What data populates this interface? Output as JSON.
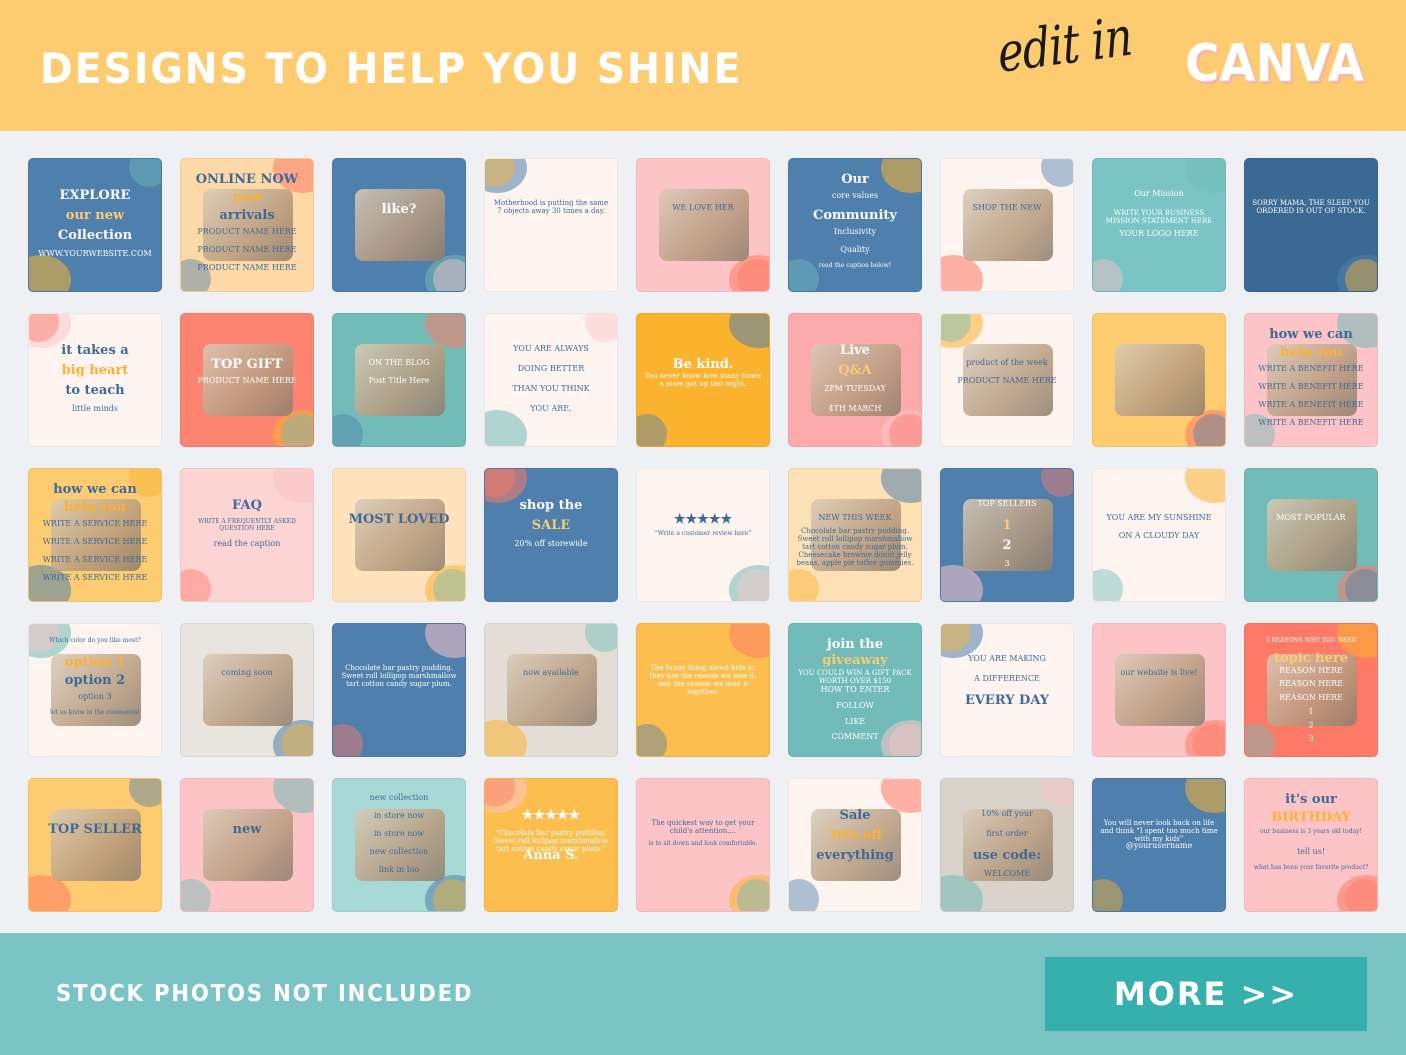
{
  "header": {
    "headline": "DESIGNS TO HELP YOU SHINE",
    "edit_in": "edit in",
    "brand": "CANVA"
  },
  "colors": {
    "header_bg": "#fecc70",
    "footer_bg": "#7ac4c5",
    "button_bg": "#36b0ac",
    "page_bg": "#eef0f4"
  },
  "templates": [
    {
      "name": "explore-new-collection",
      "bg": "#4f7fad",
      "texts": [
        "EXPLORE",
        "our new",
        "Collection",
        "WWW.YOURWEBSITE.COM"
      ]
    },
    {
      "name": "new-arrivals",
      "bg": "#fdd9a8",
      "texts": [
        "ONLINE NOW",
        "new",
        "arrivals",
        "PRODUCT NAME HERE",
        "PRODUCT NAME HERE",
        "PRODUCT NAME HERE"
      ]
    },
    {
      "name": "like",
      "bg": "#4f7fad",
      "texts": [
        "like?"
      ]
    },
    {
      "name": "motherhood-quote",
      "bg": "#fdf4f0",
      "texts": [
        "Motherhood is putting the same 7 objects away 30 times a day."
      ]
    },
    {
      "name": "we-love-her",
      "bg": "#fcc4c6",
      "texts": [
        "WE LOVE HER"
      ]
    },
    {
      "name": "core-values",
      "bg": "#4f7fad",
      "texts": [
        "Our",
        "core values",
        "Community",
        "Inclusivity",
        "Quality",
        "read the caption below!"
      ]
    },
    {
      "name": "shop-the-new",
      "bg": "#fdf4f0",
      "texts": [
        "SHOP THE NEW"
      ]
    },
    {
      "name": "our-mission",
      "bg": "#7ac4c5",
      "texts": [
        "Our Mission",
        "WRITE YOUR BUSINESS MISSION STATEMENT HERE",
        "YOUR LOGO HERE"
      ]
    },
    {
      "name": "sorry-mama",
      "bg": "#3a6a94",
      "texts": [
        "SORRY MAMA, THE SLEEP YOU ORDERED IS OUT OF STOCK."
      ]
    },
    {
      "name": "big-heart",
      "bg": "#fdf4f0",
      "texts": [
        "it takes a",
        "big heart",
        "to teach",
        "little minds"
      ]
    },
    {
      "name": "top-gift",
      "bg": "#fd8471",
      "texts": [
        "TOP GIFT",
        "PRODUCT NAME HERE"
      ]
    },
    {
      "name": "on-the-blog",
      "bg": "#71bcb8",
      "texts": [
        "ON THE BLOG",
        "Post Title Here"
      ]
    },
    {
      "name": "doing-better",
      "bg": "#fdf4f0",
      "texts": [
        "YOU ARE ALWAYS",
        "DOING BETTER",
        "THAN YOU THINK",
        "YOU ARE."
      ]
    },
    {
      "name": "be-kind",
      "bg": "#fbb22f",
      "texts": [
        "Be kind.",
        "You never know how many times a mom got up last night."
      ]
    },
    {
      "name": "live-qa",
      "bg": "#fdaaac",
      "texts": [
        "Live",
        "Q&A",
        "2PM TUESDAY",
        "4TH MARCH"
      ]
    },
    {
      "name": "product-of-the-week",
      "bg": "#fdf4f0",
      "texts": [
        "product of the week",
        "PRODUCT NAME HERE"
      ]
    },
    {
      "name": "stacking-toy",
      "bg": "#fecc70",
      "texts": []
    },
    {
      "name": "how-we-can-help-benefits",
      "bg": "#fcc4c6",
      "texts": [
        "how we can",
        "help you",
        "WRITE A BENEFIT HERE",
        "WRITE A BENEFIT HERE",
        "WRITE A BENEFIT HERE",
        "WRITE A BENEFIT HERE"
      ]
    },
    {
      "name": "how-we-can-help-services",
      "bg": "#fecc70",
      "texts": [
        "how we can",
        "help you",
        "WRITE A SERVICE HERE",
        "WRITE A SERVICE HERE",
        "WRITE A SERVICE HERE",
        "WRITE A SERVICE HERE"
      ]
    },
    {
      "name": "faq",
      "bg": "#fdd4d4",
      "texts": [
        "FAQ",
        "WRITE A FREQUENTLY ASKED QUESTION HERE",
        "read the caption"
      ]
    },
    {
      "name": "most-loved",
      "bg": "#fee3bd",
      "texts": [
        "MOST LOVED"
      ]
    },
    {
      "name": "sale-storewide",
      "bg": "#4f7fad",
      "texts": [
        "shop the",
        "SALE",
        "20% off storewide"
      ]
    },
    {
      "name": "customer-review",
      "bg": "#fdf4f0",
      "texts": [
        "★★★★★",
        "“Write a customer review here”"
      ]
    },
    {
      "name": "new-this-week",
      "bg": "#fee0b5",
      "texts": [
        "NEW THIS WEEK",
        "Chocolate bar pastry pudding. Sweet roll lollipop marshmallow tart cotton candy sugar plum. Cheesecake brownie donut jelly beans, apple pie toffee gummies."
      ]
    },
    {
      "name": "top-sellers",
      "bg": "#4f7fad",
      "texts": [
        "TOP SELLERS",
        "1",
        "2",
        "3"
      ]
    },
    {
      "name": "sunshine",
      "bg": "#fdf4f0",
      "texts": [
        "YOU ARE MY SUNSHINE",
        "ON A CLOUDY DAY"
      ]
    },
    {
      "name": "most-popular",
      "bg": "#71bcb8",
      "texts": [
        "MOST POPULAR"
      ]
    },
    {
      "name": "which-color",
      "bg": "#fdf4f0",
      "texts": [
        "Which color do you like most?",
        "option 1",
        "option 2",
        "option 3",
        "let us know in the comments!"
      ]
    },
    {
      "name": "coming-soon",
      "bg": "#e8e4df",
      "texts": [
        "coming soon"
      ]
    },
    {
      "name": "banner-quote",
      "bg": "#4f7fad",
      "texts": [
        "Chocolate bar pastry pudding. Sweet roll lollipop marshmallow tart cotton candy sugar plum."
      ]
    },
    {
      "name": "now-available",
      "bg": "#e3ddd6",
      "texts": [
        "now available"
      ]
    },
    {
      "name": "funny-thing",
      "bg": "#fdbe4d",
      "texts": [
        "The funny thing about kids is, they are the reason we lose it, and the reason we hold it together."
      ]
    },
    {
      "name": "giveaway",
      "bg": "#71bcb8",
      "texts": [
        "join the",
        "giveaway",
        "YOU COULD WIN A GIFT PACK WORTH OVER $150",
        "HOW TO ENTER",
        "FOLLOW",
        "LIKE",
        "COMMENT"
      ]
    },
    {
      "name": "making-a-difference",
      "bg": "#fdf4f0",
      "texts": [
        "YOU ARE MAKING",
        "A DIFFERENCE",
        "EVERY DAY"
      ]
    },
    {
      "name": "website-live",
      "bg": "#fcc4c6",
      "texts": [
        "our website is live!"
      ]
    },
    {
      "name": "three-reasons",
      "bg": "#fd7a66",
      "texts": [
        "3 REASONS WHY YOU NEED",
        "topic here",
        "REASON HERE",
        "REASON HERE",
        "REASON HERE",
        "1",
        "2",
        "3"
      ]
    },
    {
      "name": "top-seller",
      "bg": "#fecc70",
      "texts": [
        "TOP SELLER"
      ]
    },
    {
      "name": "new-toys",
      "bg": "#fcc4c6",
      "texts": [
        "new"
      ]
    },
    {
      "name": "new-collection",
      "bg": "#a7d9d7",
      "texts": [
        "new collection",
        "in store now",
        "in store now",
        "new collection",
        "link in bio"
      ]
    },
    {
      "name": "anna-review",
      "bg": "#fdbe4d",
      "texts": [
        "★★★★★",
        "“Chocolate bar pastry pudding. Sweet roll lollipop marshmallow tart cotton candy sugar plum.”",
        "Anna S."
      ]
    },
    {
      "name": "quickest-way",
      "bg": "#fcc4c6",
      "texts": [
        "The quickest way to get your child's attention....",
        "is to sit down and look comfortable."
      ]
    },
    {
      "name": "sale-30-off",
      "bg": "#fdf4f0",
      "texts": [
        "Sale",
        "30% off",
        "everything"
      ]
    },
    {
      "name": "first-order",
      "bg": "#d9d3cc",
      "texts": [
        "10% off your",
        "first order",
        "use code:",
        "WELCOME"
      ]
    },
    {
      "name": "never-look-back",
      "bg": "#4f7fad",
      "texts": [
        "You will never look back on life and think “I spent too much time with my kids”",
        "@yourusername"
      ]
    },
    {
      "name": "birthday",
      "bg": "#fcc4c6",
      "texts": [
        "it's our",
        "BIRTHDAY",
        "our business is 3 years old today!",
        "tell us!",
        "what has been your favorite product?"
      ]
    }
  ],
  "footer": {
    "disclaimer": "STOCK PHOTOS NOT INCLUDED",
    "more_label": "MORE >>"
  }
}
